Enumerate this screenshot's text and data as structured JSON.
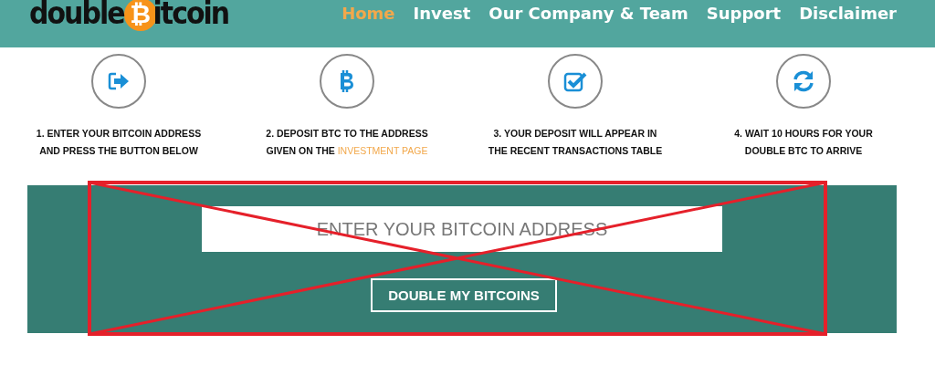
{
  "logo": {
    "before": "double",
    "symbol": "₿",
    "after": "itcoin"
  },
  "nav": [
    {
      "label": "Home",
      "selected": true
    },
    {
      "label": "Invest",
      "selected": false
    },
    {
      "label": "Our Company & Team",
      "selected": false
    },
    {
      "label": "Support",
      "selected": false
    },
    {
      "label": "Disclaimer",
      "selected": false
    }
  ],
  "steps": [
    {
      "kind": "enter",
      "text": "1. ENTER YOUR BITCOIN ADDRESS AND PRESS THE BUTTON BELOW"
    },
    {
      "kind": "bitcoin",
      "text": "2. DEPOSIT BTC TO THE ADDRESS GIVEN ON THE",
      "link": "INVESTMENT PAGE"
    },
    {
      "kind": "check",
      "text": "3. YOUR DEPOSIT WILL APPEAR IN THE RECENT TRANSACTIONS TABLE"
    },
    {
      "kind": "refresh",
      "text": "4. WAIT 10 HOURS FOR YOUR DOUBLE BTC TO ARRIVE"
    }
  ],
  "form": {
    "placeholder": "ENTER YOUR BITCOIN ADDRESS",
    "button": "DOUBLE MY BITCOINS",
    "crossed_out": true
  }
}
